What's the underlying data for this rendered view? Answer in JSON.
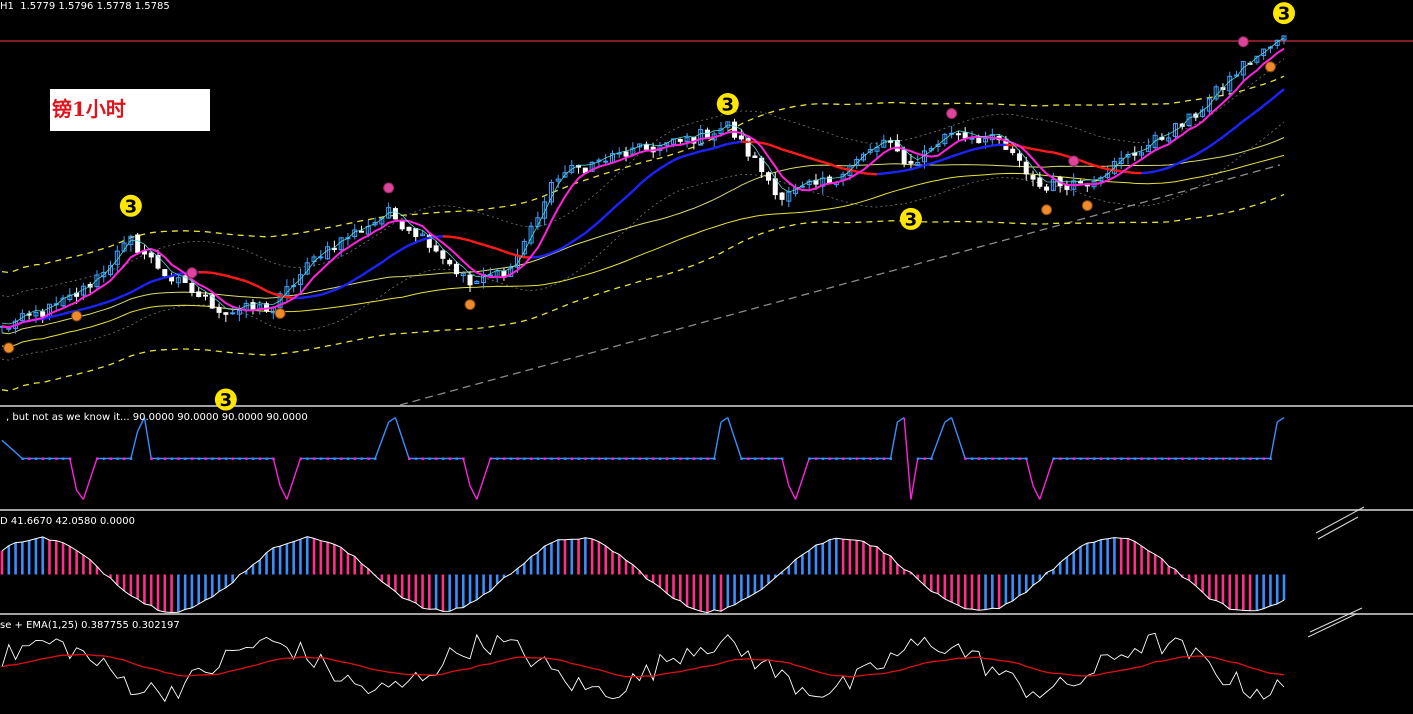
{
  "main": {
    "symbol_tf": "H1",
    "ohlc": "1.5779 1.5796 1.5778 1.5785",
    "label": "镑1小时",
    "count_marker": "3"
  },
  "panels": {
    "p2_header": ", but not as we know it...  90.0000 90.0000 90.0000 90.0000",
    "p3_header": "D 41.6670 42.0580 0.0000",
    "p4_header": "se + EMA(1,25) 0.387755 0.302197"
  },
  "colors": {
    "background": "#000000",
    "bull_candle": "#3fa0ff",
    "bear_candle": "#ffffff",
    "bollinger": "#e8e23a",
    "slow_ma_red": "#ff1a1a",
    "slow_ma_blue": "#1b24ff",
    "fast_ma_magenta": "#ff22dd",
    "histogram_pink": "#ff2f8a",
    "histogram_blue": "#3a8dff",
    "osc_white": "#ffffff",
    "osc_ema_red": "#e01010",
    "marker_yellow": "#ffe600",
    "marker_orange": "#f08a2a",
    "marker_magenta": "#e0449a",
    "resistance_line": "#c8323c"
  },
  "chart_data": [
    {
      "type": "candlestick",
      "panel": "price",
      "symbol": "H1",
      "last_ohlc": {
        "open": 1.5779,
        "high": 1.5796,
        "low": 1.5778,
        "close": 1.5785
      },
      "ylim": [
        1.545,
        1.582
      ],
      "bars": 190,
      "overlays": [
        "bollinger_bands",
        "moving_average_red_blue",
        "moving_average_magenta",
        "moving_average_yellow",
        "trend_channel_dashed"
      ],
      "markers_3": [
        {
          "bar": 19,
          "y": 1.5632,
          "position": "above"
        },
        {
          "bar": 33,
          "y": 1.5455,
          "position": "below"
        },
        {
          "bar": 107,
          "y": 1.5725,
          "position": "above"
        },
        {
          "bar": 134,
          "y": 1.562,
          "position": "below"
        },
        {
          "bar": 189,
          "y": 1.5808,
          "position": "above"
        }
      ],
      "small_marker_bars_top": [
        28,
        57,
        140,
        158,
        183
      ],
      "small_marker_bars_bottom": [
        1,
        11,
        41,
        69,
        154,
        160,
        187
      ]
    },
    {
      "type": "line",
      "panel": "indicator_2",
      "values_shown": [
        90.0,
        90.0,
        90.0,
        90.0
      ],
      "ylim": [
        -100,
        100
      ],
      "steps": [
        {
          "bar": 0,
          "y": 40
        },
        {
          "bar": 3,
          "y": 0
        },
        {
          "bar": 10,
          "y": 0
        },
        {
          "bar": 11,
          "y": -70
        },
        {
          "bar": 12,
          "y": -90
        },
        {
          "bar": 14,
          "y": 0
        },
        {
          "bar": 19,
          "y": 0
        },
        {
          "bar": 20,
          "y": 60
        },
        {
          "bar": 21,
          "y": 90
        },
        {
          "bar": 22,
          "y": 0
        },
        {
          "bar": 40,
          "y": 0
        },
        {
          "bar": 41,
          "y": -60
        },
        {
          "bar": 42,
          "y": -90
        },
        {
          "bar": 44,
          "y": 0
        },
        {
          "bar": 55,
          "y": 0
        },
        {
          "bar": 57,
          "y": 80
        },
        {
          "bar": 58,
          "y": 90
        },
        {
          "bar": 60,
          "y": 0
        },
        {
          "bar": 68,
          "y": 0
        },
        {
          "bar": 69,
          "y": -60
        },
        {
          "bar": 70,
          "y": -90
        },
        {
          "bar": 72,
          "y": 0
        },
        {
          "bar": 105,
          "y": 0
        },
        {
          "bar": 106,
          "y": 80
        },
        {
          "bar": 107,
          "y": 90
        },
        {
          "bar": 109,
          "y": 0
        },
        {
          "bar": 115,
          "y": 0
        },
        {
          "bar": 116,
          "y": -60
        },
        {
          "bar": 117,
          "y": -90
        },
        {
          "bar": 119,
          "y": 0
        },
        {
          "bar": 131,
          "y": 0
        },
        {
          "bar": 132,
          "y": 80
        },
        {
          "bar": 133,
          "y": 90
        },
        {
          "bar": 134,
          "y": -90
        },
        {
          "bar": 135,
          "y": 0
        },
        {
          "bar": 137,
          "y": 0
        },
        {
          "bar": 139,
          "y": 80
        },
        {
          "bar": 140,
          "y": 90
        },
        {
          "bar": 142,
          "y": 0
        },
        {
          "bar": 151,
          "y": 0
        },
        {
          "bar": 152,
          "y": -60
        },
        {
          "bar": 153,
          "y": -90
        },
        {
          "bar": 155,
          "y": 0
        },
        {
          "bar": 187,
          "y": 0
        },
        {
          "bar": 188,
          "y": 80
        },
        {
          "bar": 189,
          "y": 90
        }
      ]
    },
    {
      "type": "histogram",
      "panel": "indicator_3",
      "values_shown": [
        41.667,
        42.058,
        0.0
      ],
      "ylim": [
        -50,
        50
      ]
    },
    {
      "type": "line",
      "panel": "indicator_4",
      "series": [
        {
          "name": "se",
          "last": 0.387755
        },
        {
          "name": "EMA(1,25)",
          "last": 0.302197
        }
      ],
      "ylim": [
        -1,
        1
      ]
    }
  ]
}
